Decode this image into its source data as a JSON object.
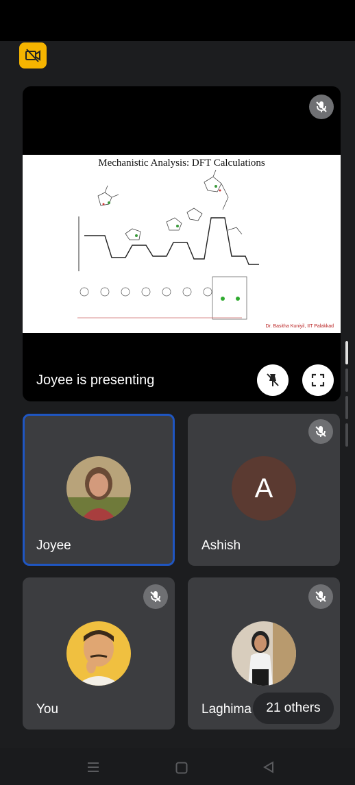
{
  "presentation": {
    "presenting_label": "Joyee is presenting",
    "slide_title": "Mechanistic Analysis: DFT Calculations",
    "slide_credit": "Dr. Basitha Kuniyil, IIT Palakkad"
  },
  "tiles": [
    {
      "name": "Joyee",
      "avatar": "photo",
      "muted": false,
      "active": true
    },
    {
      "name": "Ashish",
      "avatar_letter": "A",
      "muted": true,
      "active": false
    },
    {
      "name": "You",
      "avatar": "photo",
      "muted": true,
      "active": false
    },
    {
      "name": "Laghima",
      "avatar": "photo",
      "muted": true,
      "active": false
    }
  ],
  "others_label": "21 others",
  "icons": {
    "camera_off": "camera-off-icon",
    "mic_off": "mic-off-icon",
    "unpin": "unpin-icon",
    "fullscreen": "fullscreen-icon",
    "nav_menu": "menu-icon",
    "nav_home": "home-icon",
    "nav_back": "back-icon"
  },
  "colors": {
    "background": "#1c1d1f",
    "tile": "#3c3d40",
    "active_border": "#1f56c2",
    "badge": "#f5b400",
    "letter_avatar": "#5b3a31"
  }
}
